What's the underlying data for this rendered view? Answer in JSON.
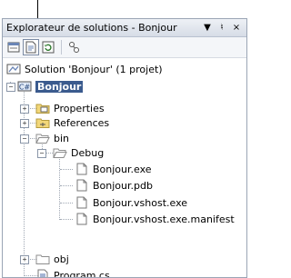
{
  "window": {
    "title": "Explorateur de solutions - Bonjour",
    "pin_glyph": "↓ ⁴",
    "close_glyph": "×"
  },
  "toolbar": {
    "icons": [
      "properties-icon",
      "show-all-files-icon",
      "refresh-icon",
      "class-diagram-icon"
    ]
  },
  "tree": {
    "solution": "Solution 'Bonjour' (1 projet)",
    "project": "Bonjour",
    "properties": "Properties",
    "references": "References",
    "bin": "bin",
    "debug": "Debug",
    "files": [
      "Bonjour.exe",
      "Bonjour.pdb",
      "Bonjour.vshost.exe",
      "Bonjour.vshost.exe.manifest"
    ],
    "obj": "obj",
    "program": "Program.cs"
  },
  "colors": {
    "selection": "#3b5b8e",
    "folder": "#f2d779",
    "tree_lines": "#a0a8b4"
  }
}
